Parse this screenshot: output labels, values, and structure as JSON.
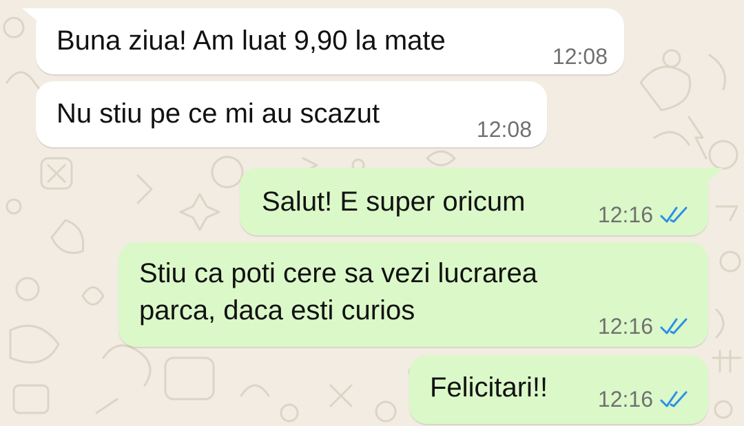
{
  "colors": {
    "wallpaper": "#f2ece2",
    "incoming_bubble": "#ffffff",
    "outgoing_bubble": "#dbf8c9",
    "read_ticks": "#2c8fe6",
    "timestamp": "#707070",
    "message_text": "#111111"
  },
  "messages": [
    {
      "direction": "incoming",
      "text": "Buna ziua! Am luat 9,90 la mate",
      "time": "12:08"
    },
    {
      "direction": "incoming",
      "text": "Nu stiu pe ce mi au scazut",
      "time": "12:08"
    },
    {
      "direction": "outgoing",
      "text": "Salut! E super oricum",
      "time": "12:16",
      "status_icon": "double-check-read-icon"
    },
    {
      "direction": "outgoing",
      "text": "Stiu ca poti cere sa vezi lucrarea\nparca, daca esti curios",
      "time": "12:16",
      "status_icon": "double-check-read-icon"
    },
    {
      "direction": "outgoing",
      "text": "Felicitari!!",
      "time": "12:16",
      "status_icon": "double-check-read-icon"
    }
  ]
}
